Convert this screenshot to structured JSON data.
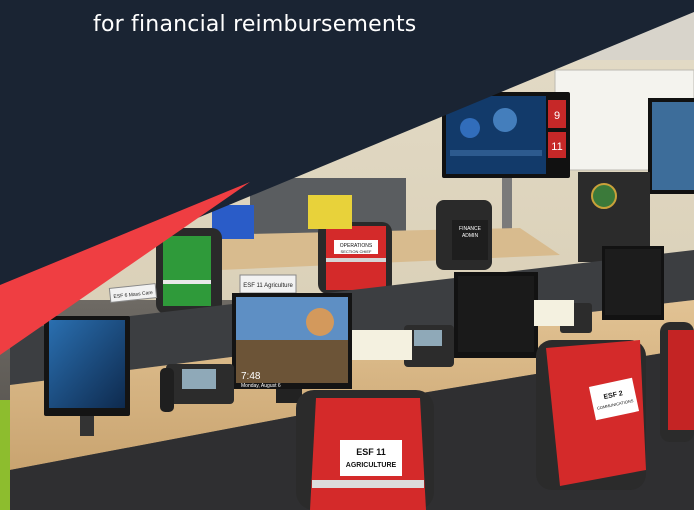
{
  "caption": {
    "line": "for financial reimbursements"
  },
  "photo_labels": {
    "esf11_vest": "ESF 11",
    "esf11_vest_sub": "AGRICULTURE",
    "esf2_vest": "ESF 2",
    "esf2_vest_sub": "COMMUNICATIONS",
    "operations_vest": "OPERATIONS",
    "operations_vest_sub": "SECTION CHIEF",
    "finance_vest": "FINANCE",
    "finance_vest_sub": "ADMIN",
    "desk_sign": "ESF 11 Agriculture",
    "desk_sign_left": "ESF 6 Mass Care",
    "monitor_time": "7:48",
    "monitor_date": "Monday, August 6",
    "screen_num_1": "9",
    "screen_num_2": "11"
  },
  "colors": {
    "navy": "#1a2433",
    "accent_red": "#ef3e42",
    "accent_green": "#8dbd2e",
    "vest_red": "#d42a2a",
    "desk_wood": "#d9b98a"
  },
  "icons": {
    "phone": "desk-phone-icon",
    "monitor": "monitor-icon"
  }
}
